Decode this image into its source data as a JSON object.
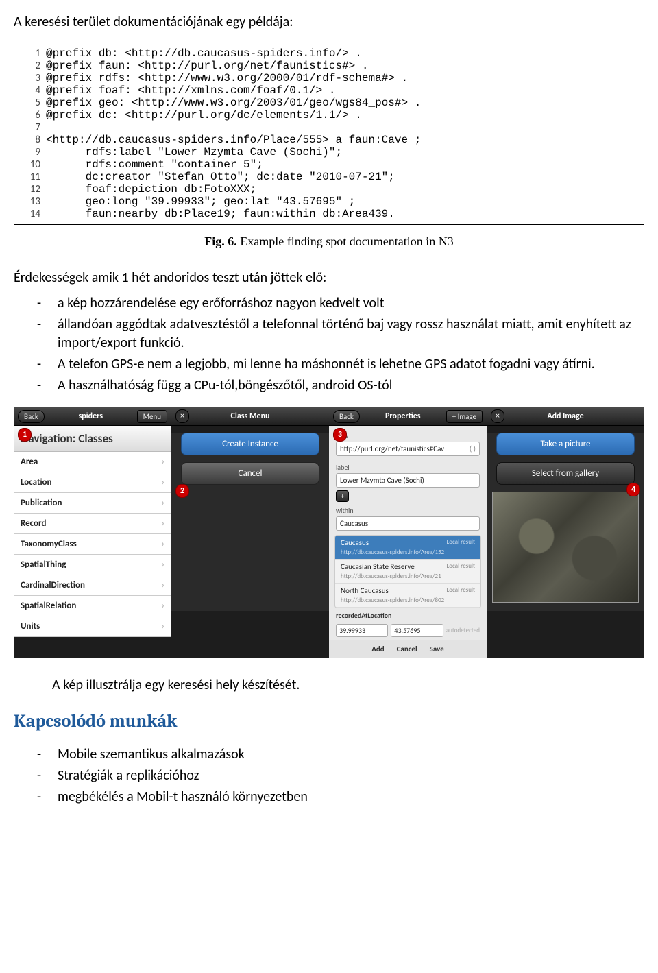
{
  "title": "A keresési terület dokumentációjának egy példája:",
  "code": {
    "lines": [
      "@prefix db: <http://db.caucasus-spiders.info/> .",
      "@prefix faun: <http://purl.org/net/faunistics#> .",
      "@prefix rdfs: <http://www.w3.org/2000/01/rdf-schema#> .",
      "@prefix foaf: <http://xmlns.com/foaf/0.1/> .",
      "@prefix geo: <http://www.w3.org/2003/01/geo/wgs84_pos#> .",
      "@prefix dc: <http://purl.org/dc/elements/1.1/> .",
      "",
      "<http://db.caucasus-spiders.info/Place/555> a faun:Cave ;",
      "      rdfs:label \"Lower Mzymta Cave (Sochi)\";",
      "      rdfs:comment \"container 5\";",
      "      dc:creator \"Stefan Otto\"; dc:date \"2010-07-21\";",
      "      foaf:depiction db:FotoXXX;",
      "      geo:long \"39.99933\"; geo:lat \"43.57695\" ;",
      "      faun:nearby db:Place19; faun:within db:Area439."
    ]
  },
  "fig_caption_bold": "Fig. 6.",
  "fig_caption_rest": " Example finding spot documentation in N3",
  "para2": "Érdekességek amik 1 hét andoridos teszt után jöttek elő:",
  "bullets1": [
    "a kép hozzárendelése egy erőforráshoz nagyon kedvelt volt",
    "állandóan aggódtak adatvesztéstől a telefonnal történő baj vagy rossz használat miatt, amit enyhített az import/export funkció.",
    "A telefon GPS-e nem a legjobb, mi lenne ha máshonnét is lehetne GPS adatot fogadni vagy átírni.",
    "A használhatóság függ a CPu-tól,böngészőtől, android OS-tól"
  ],
  "screens": {
    "s1": {
      "back": "Back",
      "title": "spiders",
      "menu": "Menu",
      "navhead": "Navigation: Classes",
      "items": [
        "Area",
        "Location",
        "Publication",
        "Record",
        "TaxonomyClass",
        "SpatialThing",
        "CardinalDirection",
        "SpatialRelation",
        "Units"
      ]
    },
    "s2": {
      "close": "×",
      "title": "Class Menu",
      "btn1": "Create Instance",
      "btn2": "Cancel"
    },
    "s3": {
      "back": "Back",
      "title": "Properties",
      "img": "+ Image",
      "lbl_type": "type",
      "val_type": "http://purl.org/net/faunistics#Cav",
      "lbl_label": "label",
      "val_label": "Lower Mzymta Cave (Sochi)",
      "lbl_within": "within",
      "val_within": "Caucasus",
      "sug1": "Caucasus",
      "sug1_sub": "http://db.caucasus-spiders.info/Area/152",
      "sug2": "Caucasian State Reserve",
      "sug2_sub": "http://db.caucasus-spiders.info/Area/21",
      "sug3": "North Caucasus",
      "sug3_sub": "http://db.caucasus-spiders.info/Area/802",
      "local": "Local result",
      "lbl_rec": "recordedAtLocation",
      "lon": "39.99933",
      "lat": "43.57695",
      "auto": "autodetected",
      "b_add": "Add",
      "b_cancel": "Cancel",
      "b_save": "Save"
    },
    "s4": {
      "close": "×",
      "title": "Add Image",
      "btn1": "Take a picture",
      "btn2": "Select from gallery"
    }
  },
  "caption_below": "A kép illusztrálja egy keresési hely készítését.",
  "section_heading": "Kapcsolódó munkák",
  "bullets2": [
    "Mobile szemantikus alkalmazások",
    "Stratégiák a replikációhoz",
    "megbékélés a Mobil-t használó környezetben"
  ]
}
